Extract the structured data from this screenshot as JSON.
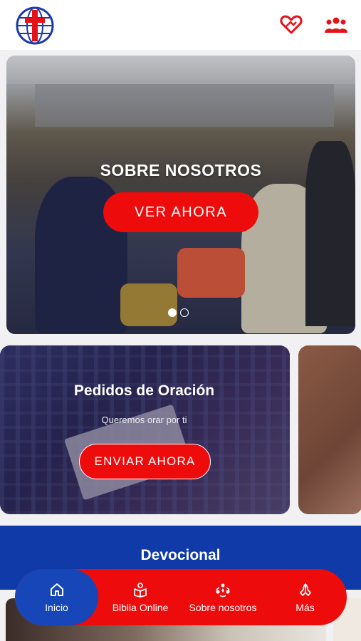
{
  "header": {
    "logo_icon": "church-globe-cross-logo",
    "actions": [
      {
        "icon": "donate-heart-hands-icon"
      },
      {
        "icon": "people-group-icon"
      }
    ]
  },
  "hero": {
    "title": "SOBRE NOSOTROS",
    "button_label": "VER AHORA",
    "carousel_pages": 2,
    "carousel_active": 1
  },
  "cards": [
    {
      "title": "Pedidos de Oración",
      "subtitle": "Queremos orar por ti",
      "button_label": "ENVIAR AHORA"
    }
  ],
  "devotional": {
    "title": "Devocional"
  },
  "bottom_nav": {
    "items": [
      {
        "label": "Inicio",
        "icon": "home-icon",
        "active": true
      },
      {
        "label": "Biblia Online",
        "icon": "bible-reading-icon",
        "active": false
      },
      {
        "label": "Sobre nosotros",
        "icon": "community-icon",
        "active": false
      },
      {
        "label": "Más",
        "icon": "praying-hands-icon",
        "active": false
      }
    ]
  },
  "colors": {
    "accent_red": "#ee0b0b",
    "brand_blue": "#1746b8",
    "devotional_blue": "#0f3aa8"
  }
}
